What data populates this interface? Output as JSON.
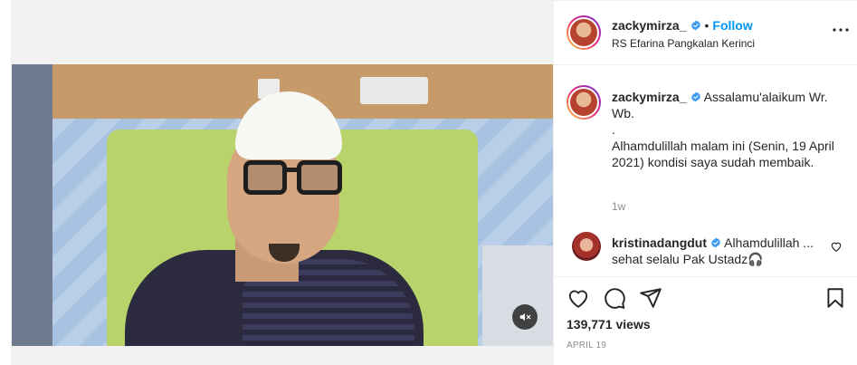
{
  "post": {
    "author": {
      "username": "zackymirza_",
      "location": "RS Efarina Pangkalan Kerinci",
      "follow_label": "Follow",
      "separator": "•"
    },
    "caption": {
      "username": "zackymirza_",
      "text": "Assalamu'alaikum Wr. Wb.\n.\nAlhamdulillah malam ini (Senin, 19 April 2021) kondisi saya sudah membaik.",
      "time_ago": "1w"
    },
    "comments": [
      {
        "username": "kristinadangdut",
        "text": "Alhamdulillah ... sehat selalu Pak Ustadz🎧"
      }
    ],
    "stats": {
      "views": "139,771 views",
      "date": "April 19"
    },
    "colors": {
      "accent": "#0095f6",
      "verified": "#3897f0",
      "muted_text": "#8e8e8e",
      "text": "#262626"
    },
    "icons": [
      "more-options-icon",
      "verified-badge-icon",
      "heart-icon",
      "comment-icon",
      "share-icon",
      "bookmark-icon",
      "mute-icon"
    ]
  }
}
